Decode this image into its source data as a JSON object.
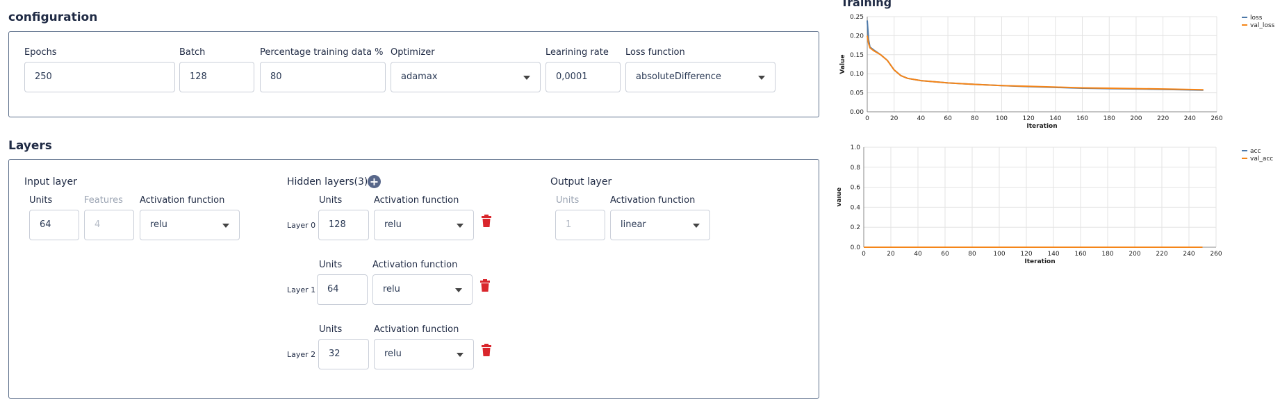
{
  "configuration": {
    "title": "configuration",
    "fields": [
      {
        "label": "Epochs",
        "value": "250"
      },
      {
        "label": "Batch",
        "value": "128"
      },
      {
        "label": "Percentage training data %",
        "value": "80"
      },
      {
        "label": "Optimizer",
        "value": "adamax"
      },
      {
        "label": "Learining rate",
        "value": "0,0001"
      },
      {
        "label": "Loss function",
        "value": "absoluteDifference"
      }
    ]
  },
  "layers": {
    "title": "Layers",
    "input": {
      "title": "Input layer",
      "units_label": "Units",
      "units_value": "64",
      "features_label": "Features",
      "features_value": "4",
      "activation_label": "Activation function",
      "activation_value": "relu"
    },
    "hidden": {
      "title": "Hidden layers(3)",
      "items": [
        {
          "tag": "Layer 0",
          "units_label": "Units",
          "units_value": "128",
          "activation_label": "Activation function",
          "activation_value": "relu"
        },
        {
          "tag": "Layer 1",
          "units_label": "Units",
          "units_value": "64",
          "activation_label": "Activation function",
          "activation_value": "relu"
        },
        {
          "tag": "Layer 2",
          "units_label": "Units",
          "units_value": "32",
          "activation_label": "Activation function",
          "activation_value": "relu"
        }
      ]
    },
    "output": {
      "title": "Output layer",
      "units_label": "Units",
      "units_value": "1",
      "activation_label": "Activation function",
      "activation_value": "linear"
    }
  },
  "training": {
    "title": "Training",
    "colors": {
      "series1": "#4c78a8",
      "series2": "#f58518",
      "trash": "#d9262c",
      "plus": "#58678a"
    }
  },
  "chart_data": [
    {
      "type": "line",
      "xlabel": "Iteration",
      "ylabel": "Value",
      "xlim": [
        0,
        260
      ],
      "ylim": [
        0,
        0.25
      ],
      "xticks": [
        0,
        20,
        40,
        60,
        80,
        100,
        120,
        140,
        160,
        180,
        200,
        220,
        240,
        260
      ],
      "yticks": [
        "0.00",
        "0.05",
        "0.10",
        "0.15",
        "0.20",
        "0.25"
      ],
      "grid": true,
      "legend_position": "top-right",
      "series": [
        {
          "name": "loss",
          "color": "#4c78a8",
          "points": [
            [
              0,
              0.24
            ],
            [
              1,
              0.19
            ],
            [
              2,
              0.17
            ],
            [
              5,
              0.162
            ],
            [
              10,
              0.15
            ],
            [
              15,
              0.135
            ],
            [
              20,
              0.11
            ],
            [
              25,
              0.095
            ],
            [
              30,
              0.088
            ],
            [
              40,
              0.082
            ],
            [
              60,
              0.076
            ],
            [
              80,
              0.072
            ],
            [
              100,
              0.069
            ],
            [
              120,
              0.066
            ],
            [
              140,
              0.064
            ],
            [
              160,
              0.062
            ],
            [
              180,
              0.061
            ],
            [
              200,
              0.06
            ],
            [
              220,
              0.059
            ],
            [
              250,
              0.057
            ]
          ]
        },
        {
          "name": "val_loss",
          "color": "#f58518",
          "points": [
            [
              0,
              0.2
            ],
            [
              1,
              0.18
            ],
            [
              2,
              0.168
            ],
            [
              5,
              0.16
            ],
            [
              10,
              0.15
            ],
            [
              15,
              0.135
            ],
            [
              20,
              0.11
            ],
            [
              25,
              0.095
            ],
            [
              30,
              0.088
            ],
            [
              40,
              0.082
            ],
            [
              60,
              0.076
            ],
            [
              80,
              0.072
            ],
            [
              100,
              0.069
            ],
            [
              120,
              0.067
            ],
            [
              140,
              0.065
            ],
            [
              160,
              0.063
            ],
            [
              180,
              0.062
            ],
            [
              200,
              0.061
            ],
            [
              220,
              0.06
            ],
            [
              250,
              0.058
            ]
          ]
        }
      ]
    },
    {
      "type": "line",
      "xlabel": "Iteration",
      "ylabel": "Value",
      "xlim": [
        0,
        260
      ],
      "ylim": [
        0,
        1.0
      ],
      "xticks": [
        0,
        20,
        40,
        60,
        80,
        100,
        120,
        140,
        160,
        180,
        200,
        220,
        240,
        260
      ],
      "yticks": [
        "0.0",
        "0.2",
        "0.4",
        "0.6",
        "0.8",
        "1.0"
      ],
      "grid": true,
      "legend_position": "top-right",
      "series": [
        {
          "name": "acc",
          "color": "#4c78a8",
          "points": [
            [
              0,
              0.0
            ],
            [
              250,
              0.0
            ]
          ]
        },
        {
          "name": "val_acc",
          "color": "#f58518",
          "points": [
            [
              0,
              0.0
            ],
            [
              250,
              0.0
            ]
          ]
        }
      ]
    }
  ]
}
